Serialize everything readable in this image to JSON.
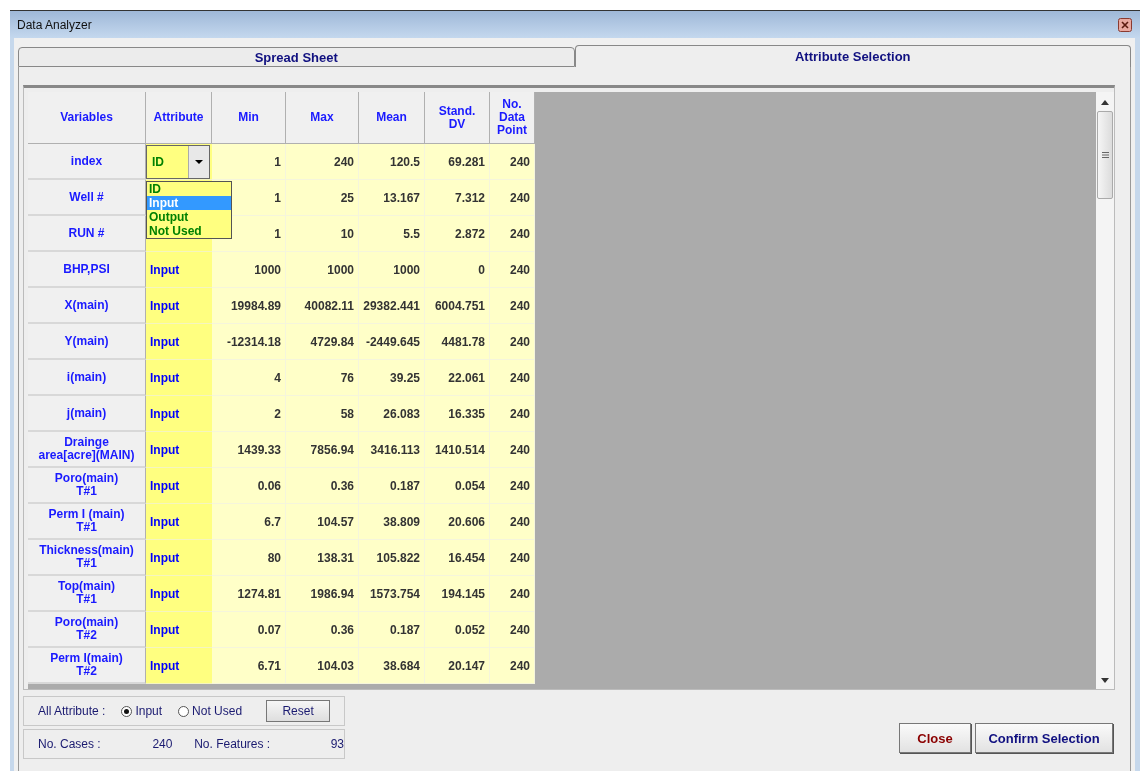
{
  "window": {
    "title": "Data Analyzer"
  },
  "tabs": [
    {
      "label": "Spread Sheet",
      "selected": false
    },
    {
      "label": "Attribute Selection",
      "selected": true
    }
  ],
  "table": {
    "columns": [
      "Variables",
      "Attribute",
      "Min",
      "Max",
      "Mean",
      "Stand.\nDV",
      "No.\nData\nPoint"
    ],
    "rows": [
      {
        "variable": "index",
        "attribute": {
          "kind": "dropdown",
          "value": "ID",
          "color": "#008000"
        },
        "min": "1",
        "max": "240",
        "mean": "120.5",
        "stdev": "69.281",
        "points": "240"
      },
      {
        "variable": "Well #",
        "min": "1",
        "max": "25",
        "mean": "13.167",
        "stdev": "7.312",
        "points": "240"
      },
      {
        "variable": "RUN #",
        "min": "1",
        "max": "10",
        "mean": "5.5",
        "stdev": "2.872",
        "points": "240"
      },
      {
        "variable": "BHP,PSI",
        "attribute": {
          "kind": "text",
          "value": "Input",
          "color": "#0000ff"
        },
        "min": "1000",
        "max": "1000",
        "mean": "1000",
        "stdev": "0",
        "points": "240"
      },
      {
        "variable": "X(main)",
        "attribute": {
          "kind": "text",
          "value": "Input",
          "color": "#0000ff"
        },
        "min": "19984.89",
        "max": "40082.11",
        "mean": "29382.441",
        "stdev": "6004.751",
        "points": "240"
      },
      {
        "variable": "Y(main)",
        "attribute": {
          "kind": "text",
          "value": "Input",
          "color": "#0000ff"
        },
        "min": "-12314.18",
        "max": "4729.84",
        "mean": "-2449.645",
        "stdev": "4481.78",
        "points": "240"
      },
      {
        "variable": "i(main)",
        "attribute": {
          "kind": "text",
          "value": "Input",
          "color": "#0000ff"
        },
        "min": "4",
        "max": "76",
        "mean": "39.25",
        "stdev": "22.061",
        "points": "240"
      },
      {
        "variable": "j(main)",
        "attribute": {
          "kind": "text",
          "value": "Input",
          "color": "#0000ff"
        },
        "min": "2",
        "max": "58",
        "mean": "26.083",
        "stdev": "16.335",
        "points": "240"
      },
      {
        "variable": "Drainge\narea[acre](MAIN)",
        "attribute": {
          "kind": "text",
          "value": "Input",
          "color": "#0000ff"
        },
        "min": "1439.33",
        "max": "7856.94",
        "mean": "3416.113",
        "stdev": "1410.514",
        "points": "240"
      },
      {
        "variable": "Poro(main)\nT#1",
        "attribute": {
          "kind": "text",
          "value": "Input",
          "color": "#0000ff"
        },
        "min": "0.06",
        "max": "0.36",
        "mean": "0.187",
        "stdev": "0.054",
        "points": "240"
      },
      {
        "variable": "Perm I (main)\nT#1",
        "attribute": {
          "kind": "text",
          "value": "Input",
          "color": "#0000ff"
        },
        "min": "6.7",
        "max": "104.57",
        "mean": "38.809",
        "stdev": "20.606",
        "points": "240"
      },
      {
        "variable": "Thickness(main)\nT#1",
        "attribute": {
          "kind": "text",
          "value": "Input",
          "color": "#0000ff"
        },
        "min": "80",
        "max": "138.31",
        "mean": "105.822",
        "stdev": "16.454",
        "points": "240"
      },
      {
        "variable": "Top(main)\nT#1",
        "attribute": {
          "kind": "text",
          "value": "Input",
          "color": "#0000ff"
        },
        "min": "1274.81",
        "max": "1986.94",
        "mean": "1573.754",
        "stdev": "194.145",
        "points": "240"
      },
      {
        "variable": "Poro(main)\nT#2",
        "attribute": {
          "kind": "text",
          "value": "Input",
          "color": "#0000ff"
        },
        "min": "0.07",
        "max": "0.36",
        "mean": "0.187",
        "stdev": "0.052",
        "points": "240"
      },
      {
        "variable": "Perm I(main)\nT#2",
        "attribute": {
          "kind": "text",
          "value": "Input",
          "color": "#0000ff"
        },
        "min": "6.71",
        "max": "104.03",
        "mean": "38.684",
        "stdev": "20.147",
        "points": "240"
      }
    ],
    "dropdown": {
      "options": [
        {
          "label": "ID",
          "selected": false
        },
        {
          "label": "Input",
          "selected": true
        },
        {
          "label": "Output",
          "selected": false
        },
        {
          "label": "Not Used",
          "selected": false
        }
      ]
    }
  },
  "all_attribute": {
    "label": "All Attribute :",
    "options": [
      {
        "label": "Input",
        "selected": true
      },
      {
        "label": "Not Used",
        "selected": false
      }
    ],
    "reset": "Reset"
  },
  "stats": [
    {
      "label": "No. Cases :",
      "value": "240"
    },
    {
      "label": "No. Features :",
      "value": "93"
    }
  ],
  "buttons": [
    {
      "label": "Close",
      "kind": "close"
    },
    {
      "label": "Confirm Selection",
      "kind": "confirm"
    }
  ]
}
